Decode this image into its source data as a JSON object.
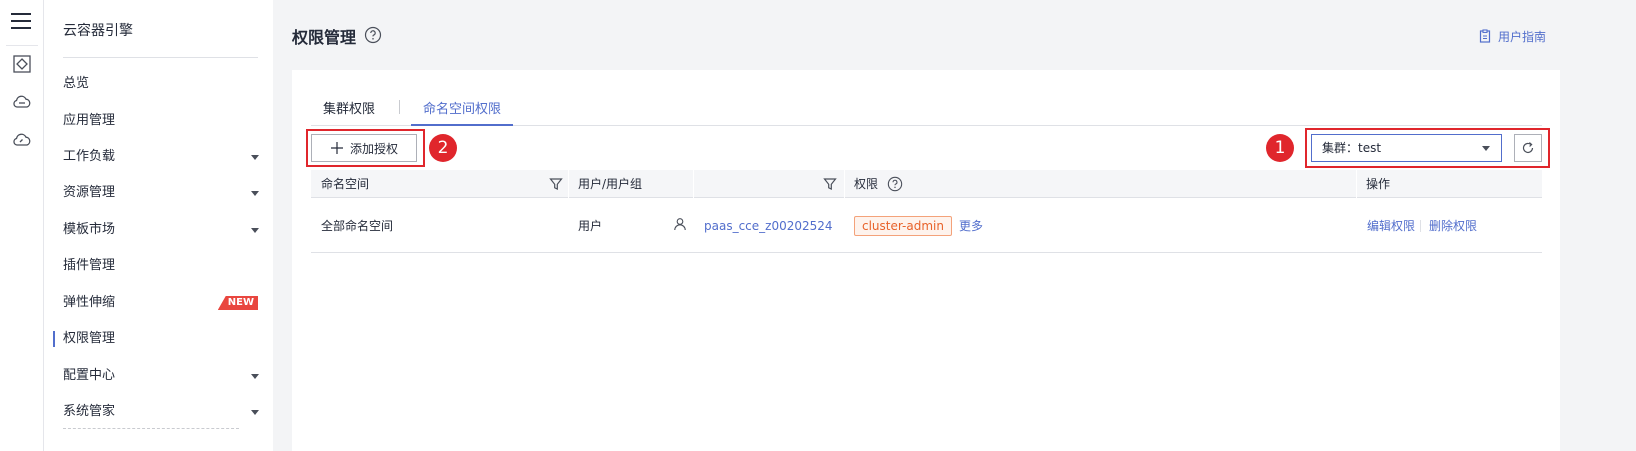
{
  "rail": {
    "menu_icon": "hamburger-menu-icon",
    "icons": [
      "container-engine-icon",
      "cloud-icon",
      "cloud-monitor-icon"
    ]
  },
  "sidebar": {
    "title": "云容器引擎",
    "items": [
      {
        "label": "总览",
        "has_children": false
      },
      {
        "label": "应用管理",
        "has_children": false
      },
      {
        "label": "工作负载",
        "has_children": true
      },
      {
        "label": "资源管理",
        "has_children": true
      },
      {
        "label": "模板市场",
        "has_children": true
      },
      {
        "label": "插件管理",
        "has_children": false
      },
      {
        "label": "弹性伸缩",
        "has_children": false,
        "badge": "NEW"
      },
      {
        "label": "权限管理",
        "has_children": false,
        "active": true
      },
      {
        "label": "配置中心",
        "has_children": true
      },
      {
        "label": "系统管家",
        "has_children": true
      }
    ]
  },
  "header": {
    "title": "权限管理",
    "guide_label": "用户指南"
  },
  "tabs": [
    {
      "label": "集群权限",
      "active": false
    },
    {
      "label": "命名空间权限",
      "active": true
    }
  ],
  "toolbar": {
    "add_label": "添加授权",
    "cluster_select": "集群：test"
  },
  "annotations": {
    "badge_1": "1",
    "badge_2": "2"
  },
  "table": {
    "columns": [
      "命名空间",
      "用户/用户组",
      "权限",
      "操作"
    ],
    "rows": [
      {
        "namespace": "全部命名空间",
        "user_type": "用户",
        "user_name": "paas_cce_z00202524",
        "permission": "cluster-admin",
        "more": "更多",
        "actions": [
          "编辑权限",
          "删除权限"
        ]
      }
    ]
  },
  "colors": {
    "accent": "#526ecc",
    "highlight": "#e0262c",
    "tag_orange": "#e8622a",
    "new_badge": "#e9463f"
  }
}
